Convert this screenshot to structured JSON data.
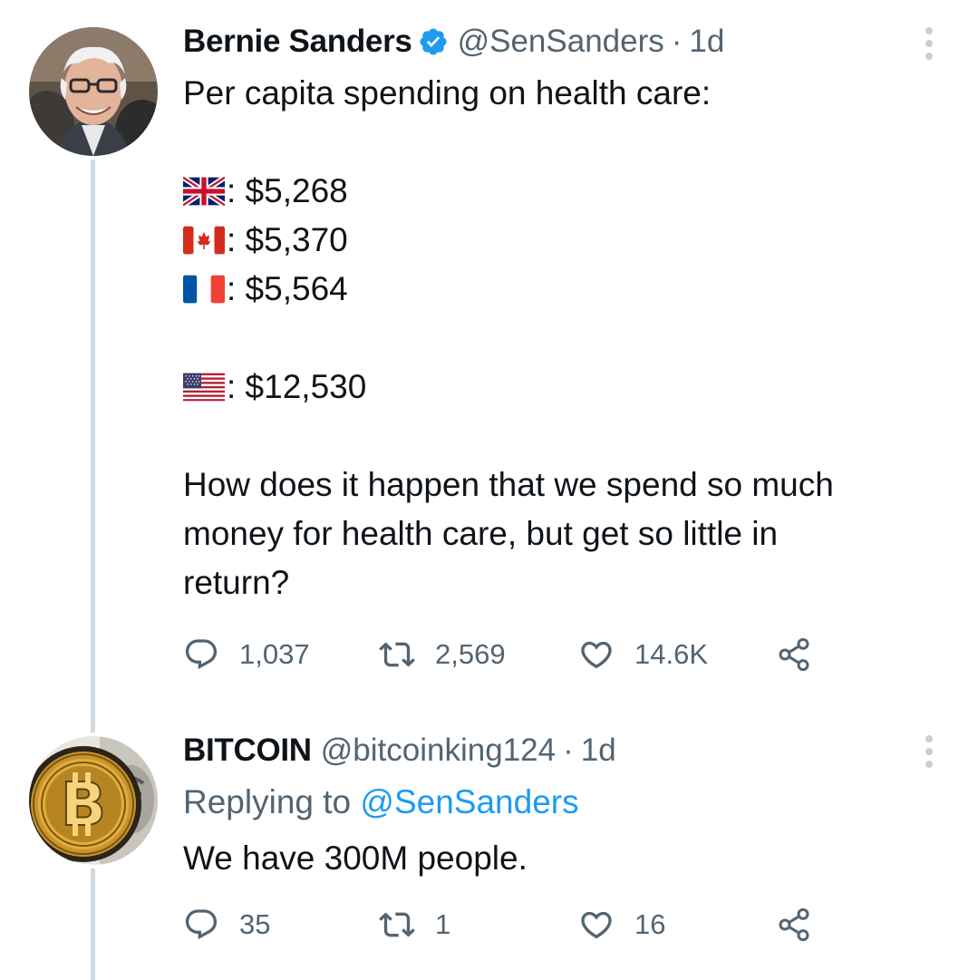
{
  "tweets": [
    {
      "name": "Bernie Sanders",
      "handle": "@SenSanders",
      "separator": "·",
      "time": "1d",
      "verified": true,
      "lines": {
        "intro": "Per capita spending on health care:",
        "uk": ": $5,268",
        "canada": ": $5,370",
        "france": ": $5,564",
        "usa": ": $12,530",
        "question_1": "How does it happen that we spend so much",
        "question_2": "money for health care, but get so little in",
        "question_3": "return?"
      },
      "flags": [
        "flag-uk-icon",
        "flag-canada-icon",
        "flag-france-icon",
        "flag-usa-icon"
      ],
      "stats": {
        "replies": "1,037",
        "retweets": "2,569",
        "likes": "14.6K"
      }
    },
    {
      "name": "BITCOIN",
      "handle": "@bitcoinking124",
      "separator": "·",
      "time": "1d",
      "replying_prefix": "Replying to ",
      "replying_to": "@SenSanders",
      "text": "We have 300M people.",
      "stats": {
        "replies": "35",
        "retweets": "1",
        "likes": "16"
      }
    }
  ],
  "colors": {
    "text": "#0f1419",
    "secondary": "#536471",
    "link": "#1d9bf0",
    "thread_line": "#cfd9de",
    "verified": "#1d9bf0"
  }
}
